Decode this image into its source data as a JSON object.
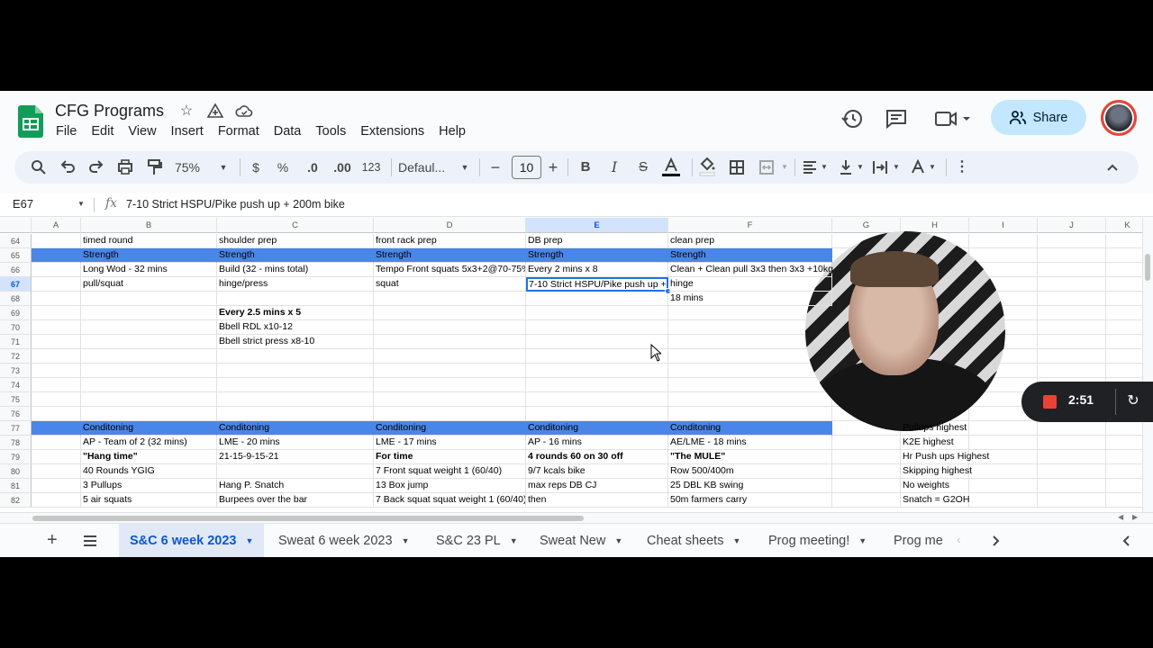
{
  "doc": {
    "title": "CFG Programs"
  },
  "menu": [
    "File",
    "Edit",
    "View",
    "Insert",
    "Format",
    "Data",
    "Tools",
    "Extensions",
    "Help"
  ],
  "header": {
    "share_label": "Share"
  },
  "toolbar": {
    "zoom": "75%",
    "currency": "$",
    "percent": "%",
    "dec_decrease": ".0",
    "dec_increase": ".00",
    "number_format": "123",
    "font": "Defaul...",
    "font_size": "10",
    "bold": "B",
    "italic": "I",
    "strike": "S"
  },
  "formula_bar": {
    "cell_ref": "E67",
    "fx": "fx",
    "content": "7-10 Strict HSPU/Pike push up + 200m bike"
  },
  "columns": [
    "A",
    "B",
    "C",
    "D",
    "E",
    "F",
    "G",
    "H",
    "I",
    "J",
    "K"
  ],
  "rows": [
    {
      "n": "64",
      "cells": [
        "",
        "timed round",
        "shoulder prep",
        "front rack prep",
        "DB prep",
        "clean prep",
        "",
        "",
        "",
        "",
        ""
      ]
    },
    {
      "n": "65",
      "band": true,
      "cells": [
        "",
        "Strength",
        "Strength",
        "Strength",
        "Strength",
        "Strength",
        "",
        "",
        "",
        "",
        ""
      ]
    },
    {
      "n": "66",
      "cells": [
        "",
        "Long Wod - 32 mins",
        "Build (32 - mins total)",
        "Tempo Front squats 5x3+2@70-75%",
        "Every 2 mins x 8",
        "Clean + Clean pull 3x3 then 3x3 +10kg",
        "",
        "",
        "",
        "",
        ""
      ]
    },
    {
      "n": "67",
      "cells": [
        "",
        "pull/squat",
        "hinge/press",
        "squat",
        "7-10 Strict HSPU/Pike push up + 200m bike",
        "hinge",
        "",
        "",
        "",
        "",
        ""
      ]
    },
    {
      "n": "68",
      "cells": [
        "",
        "",
        "",
        "",
        "",
        "18 mins",
        "",
        "",
        "",
        "",
        ""
      ]
    },
    {
      "n": "69",
      "cells": [
        "",
        "",
        "Every 2.5 mins x 5",
        "",
        "",
        "",
        "",
        "",
        "",
        "",
        ""
      ],
      "bold": [
        2
      ]
    },
    {
      "n": "70",
      "cells": [
        "",
        "",
        "Bbell RDL x10-12",
        "",
        "",
        "",
        "",
        "",
        "",
        "",
        ""
      ]
    },
    {
      "n": "71",
      "cells": [
        "",
        "",
        "Bbell strict press x8-10",
        "",
        "",
        "",
        "",
        "",
        "",
        "",
        ""
      ]
    },
    {
      "n": "72",
      "cells": [
        "",
        "",
        "",
        "",
        "",
        "",
        "",
        "",
        "",
        "",
        ""
      ]
    },
    {
      "n": "73",
      "cells": [
        "",
        "",
        "",
        "",
        "",
        "",
        "",
        "",
        "",
        "",
        ""
      ]
    },
    {
      "n": "74",
      "cells": [
        "",
        "",
        "",
        "",
        "",
        "",
        "",
        "",
        "",
        "",
        ""
      ]
    },
    {
      "n": "75",
      "cells": [
        "",
        "",
        "",
        "",
        "",
        "",
        "",
        "",
        "",
        "",
        ""
      ]
    },
    {
      "n": "76",
      "cells": [
        "",
        "",
        "",
        "",
        "",
        "",
        "",
        "",
        "",
        "",
        ""
      ]
    },
    {
      "n": "77",
      "band": true,
      "cells": [
        "",
        "Conditoning",
        "Conditoning",
        "Conditoning",
        "Conditoning",
        "Conditoning",
        "",
        "Pullups highest",
        "",
        "",
        ""
      ]
    },
    {
      "n": "78",
      "cells": [
        "",
        "AP - Team of 2 (32 mins)",
        "LME - 20 mins",
        "LME - 17 mins",
        "AP - 16 mins",
        "AE/LME - 18 mins",
        "",
        "K2E highest",
        "",
        "",
        ""
      ]
    },
    {
      "n": "79",
      "cells": [
        "",
        "\"Hang time\"",
        "21-15-9-15-21",
        "For time",
        "4 rounds 60 on 30 off",
        "\"The MULE\"",
        "",
        "Hr Push ups Highest",
        "",
        "",
        ""
      ],
      "bold": [
        1,
        3,
        4,
        5
      ]
    },
    {
      "n": "80",
      "cells": [
        "",
        "40 Rounds YGIG",
        "",
        "7 Front squat weight 1 (60/40)",
        "9/7 kcals bike",
        "Row 500/400m",
        "",
        "Skipping highest",
        "",
        "",
        ""
      ]
    },
    {
      "n": "81",
      "cells": [
        "",
        "3 Pullups",
        "Hang P. Snatch",
        "13 Box jump",
        "max reps DB CJ",
        "25 DBL KB swing",
        "",
        "No weights",
        "",
        "",
        ""
      ]
    },
    {
      "n": "82",
      "cells": [
        "",
        "5 air squats",
        "Burpees over the bar",
        "7 Back squat squat weight 1 (60/40)",
        "then",
        "50m farmers carry",
        "",
        "Snatch = G2OH",
        "",
        "",
        ""
      ]
    }
  ],
  "sheet_tabs": [
    "S&C 6 week 2023",
    "Sweat 6 week 2023",
    "S&C 23 PL",
    "Sweat New",
    "Cheat sheets",
    "Prog meeting!",
    "Prog me"
  ],
  "recorder": {
    "time": "2:51"
  }
}
